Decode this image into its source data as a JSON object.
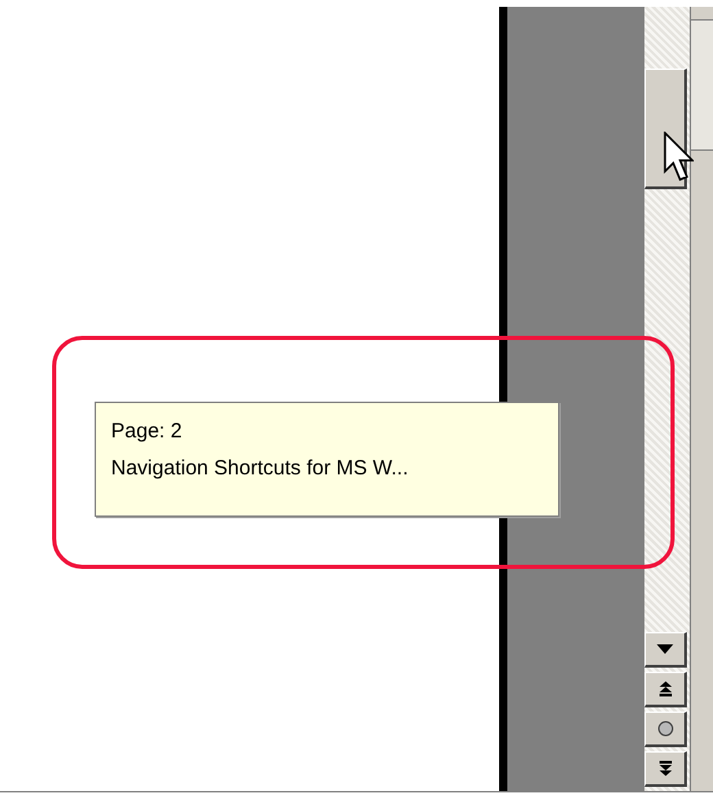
{
  "tooltip": {
    "lines": [
      "Page: 2",
      "Navigation Shortcuts for MS W..."
    ]
  }
}
